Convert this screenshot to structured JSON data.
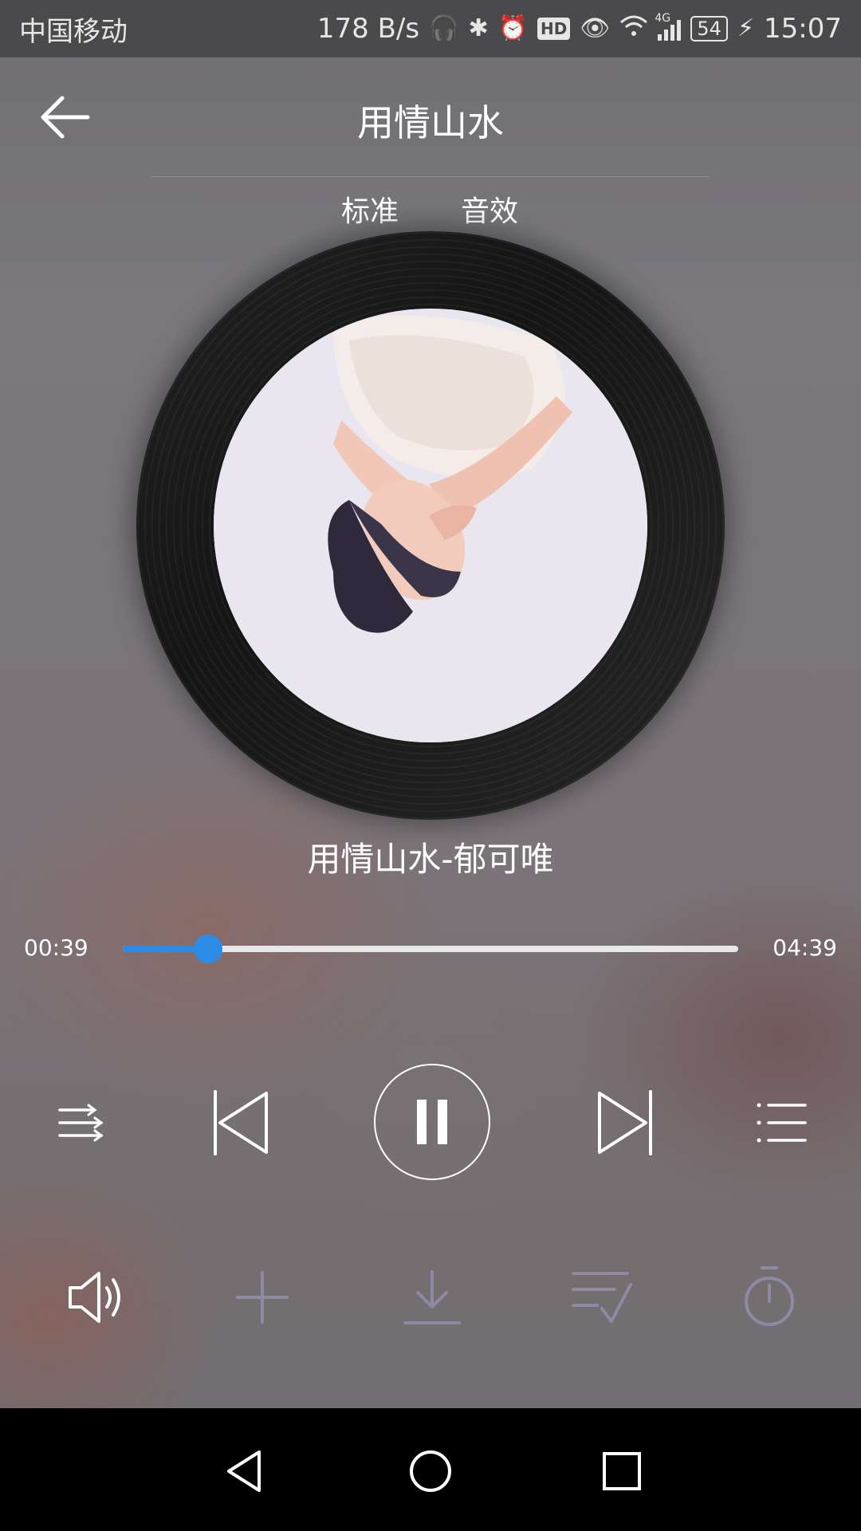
{
  "status_bar": {
    "carrier": "中国移动",
    "net_speed": "178 B/s",
    "hd": "HD",
    "signal_label": "4G",
    "battery": "54",
    "time": "15:07"
  },
  "header": {
    "title": "用情山水"
  },
  "tabs": [
    {
      "label": "标准"
    },
    {
      "label": "音效"
    }
  ],
  "now_playing": {
    "song_artist": "用情山水-郁可唯",
    "current_time": "00:39",
    "total_time": "04:39",
    "progress": 0.139
  },
  "colors": {
    "accent": "#2b8be6",
    "disabled_icon": "#8e8aa3"
  },
  "icons": {
    "back": "arrow-left-icon",
    "shuffle": "playlist-order-icon",
    "previous": "skip-previous-icon",
    "pause": "pause-icon",
    "next": "skip-next-icon",
    "playlist": "playlist-icon",
    "volume": "volume-icon",
    "add": "plus-icon",
    "download": "download-icon",
    "add_to_list": "add-to-list-icon",
    "timer": "timer-icon"
  }
}
